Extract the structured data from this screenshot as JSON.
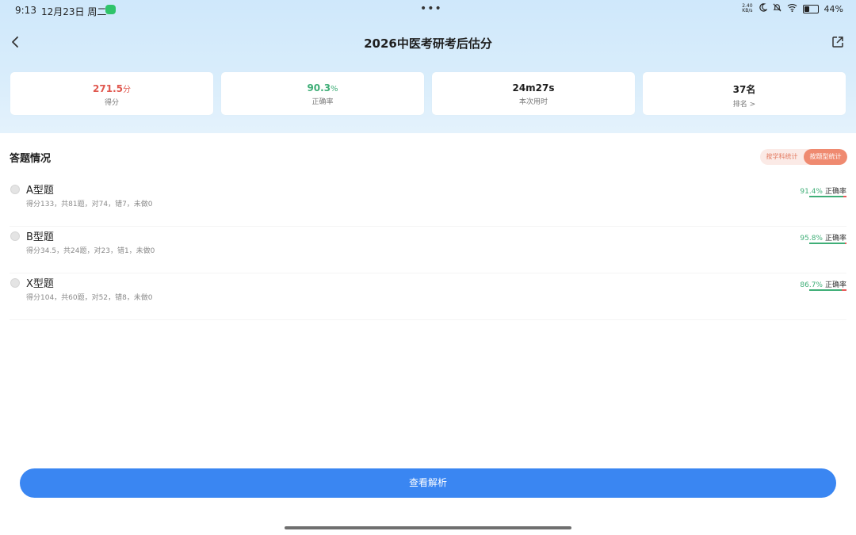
{
  "status_bar": {
    "time": "9:13",
    "date": "12月23日 周二",
    "net_speed_value": "2.40",
    "net_speed_unit": "KB/s",
    "battery": "44%",
    "battery_level": 0.44
  },
  "header": {
    "title": "2026中医考研考后估分"
  },
  "stats": [
    {
      "value": "271.5",
      "unit": "分",
      "label": "得分",
      "color": "#e0584f"
    },
    {
      "value": "90.3",
      "unit": "%",
      "label": "正确率",
      "color": "#3fae77"
    },
    {
      "value": "24m27s",
      "unit": "",
      "label": "本次用时",
      "color": "#1e1e1e"
    },
    {
      "value": "37名",
      "unit": "",
      "label": "排名 >",
      "color": "#1e1e1e"
    }
  ],
  "section": {
    "title": "答题情况",
    "toggle_options": [
      "按学科统计",
      "按题型统计"
    ],
    "active_toggle": 1
  },
  "questions": [
    {
      "name": "A型题",
      "detail": "得分133，共81题，对74，错7，未做0",
      "rate": "91.4%",
      "rate_value": 0.914,
      "rate_label": "正确率"
    },
    {
      "name": "B型题",
      "detail": "得分34.5，共24题，对23，错1，未做0",
      "rate": "95.8%",
      "rate_value": 0.958,
      "rate_label": "正确率"
    },
    {
      "name": "X型题",
      "detail": "得分104，共60题，对52，错8，未做0",
      "rate": "86.7%",
      "rate_value": 0.867,
      "rate_label": "正确率"
    }
  ],
  "action": {
    "label": "查看解析"
  },
  "colors": {
    "accent_blue": "#3a86f2",
    "success_green": "#3fae77",
    "error_red": "#e85a5a",
    "toggle_active": "#ef8a70"
  }
}
